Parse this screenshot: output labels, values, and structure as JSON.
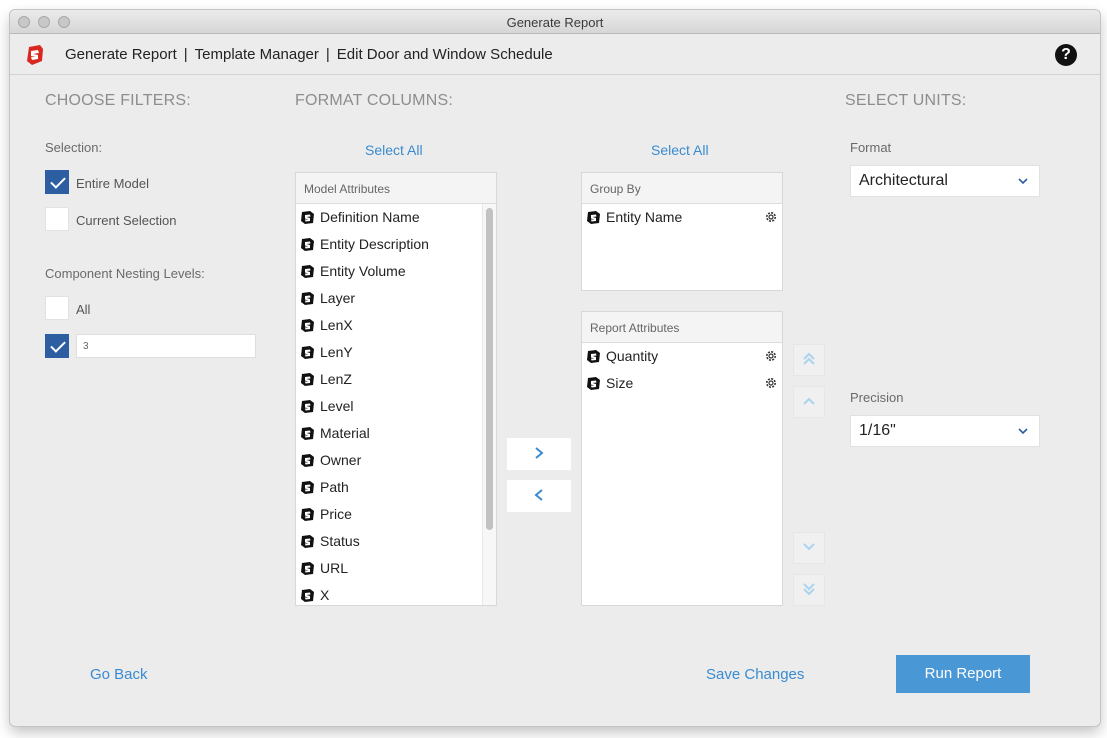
{
  "window": {
    "title": "Generate Report"
  },
  "header": {
    "breadcrumb": [
      "Generate Report",
      "Template Manager",
      "Edit Door and Window Schedule"
    ],
    "separator": "|",
    "help_label": "?"
  },
  "filters": {
    "title": "CHOOSE FILTERS:",
    "selection_label": "Selection:",
    "entire_model": {
      "label": "Entire Model",
      "checked": true
    },
    "current_selection": {
      "label": "Current Selection",
      "checked": false
    },
    "nesting_label": "Component Nesting Levels:",
    "all": {
      "label": "All",
      "checked": false
    },
    "levels": {
      "checked": true,
      "value": "3"
    }
  },
  "columns": {
    "title": "FORMAT COLUMNS:",
    "select_all_left": "Select All",
    "select_all_right": "Select All",
    "model_attributes": {
      "header": "Model Attributes",
      "items": [
        "Definition Name",
        "Entity Description",
        "Entity Volume",
        "Layer",
        "LenX",
        "LenY",
        "LenZ",
        "Level",
        "Material",
        "Owner",
        "Path",
        "Price",
        "Status",
        "URL",
        "X"
      ]
    },
    "group_by": {
      "header": "Group By",
      "items": [
        "Entity Name"
      ]
    },
    "report_attributes": {
      "header": "Report Attributes",
      "items": [
        "Quantity",
        "Size"
      ]
    }
  },
  "units": {
    "title": "SELECT UNITS:",
    "format_label": "Format",
    "format_value": "Architectural",
    "precision_label": "Precision",
    "precision_value": "1/16\""
  },
  "footer": {
    "go_back": "Go Back",
    "save_changes": "Save Changes",
    "run_report": "Run Report"
  },
  "colors": {
    "accent": "#3a8bd0",
    "checkbox": "#2d5ea2",
    "primary_button": "#4a97d6",
    "arrow_light": "#a9d3ef"
  }
}
